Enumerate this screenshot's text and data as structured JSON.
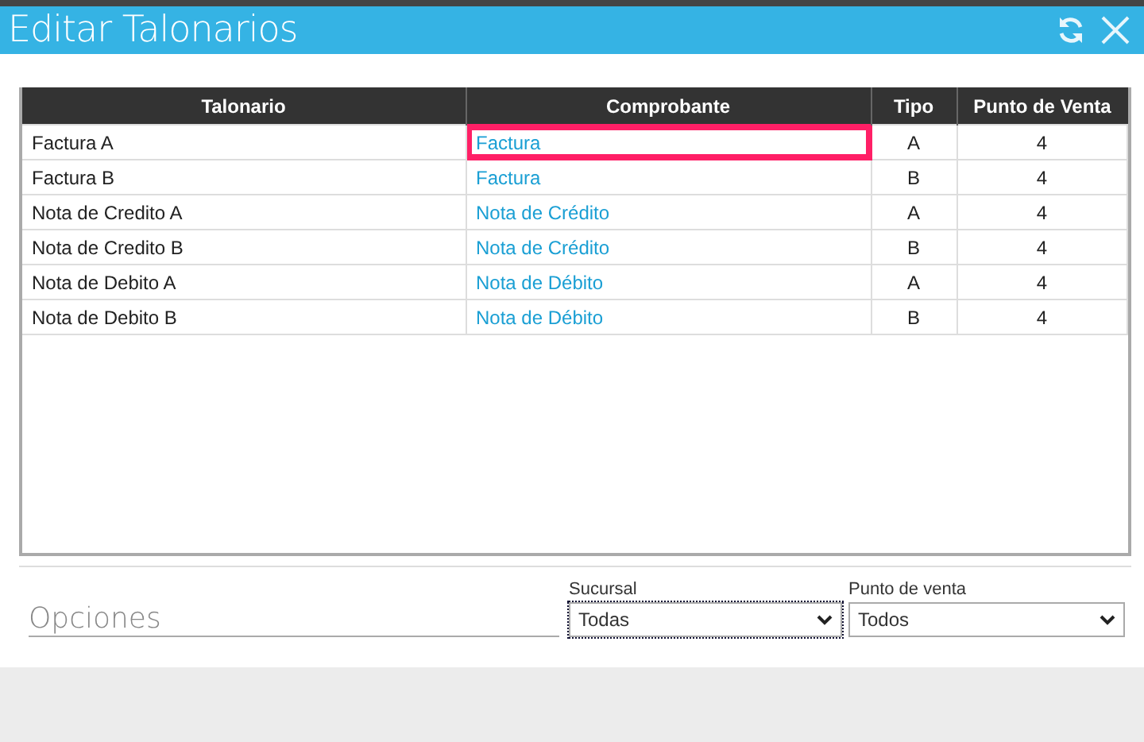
{
  "window": {
    "title": "Editar Talonarios"
  },
  "table": {
    "columns": [
      "Talonario",
      "Comprobante",
      "Tipo",
      "Punto de Venta"
    ],
    "rows": [
      {
        "talonario": "Factura A",
        "comprobante": "Factura",
        "tipo": "A",
        "punto_de_venta": "4",
        "highlighted": true
      },
      {
        "talonario": "Factura B",
        "comprobante": "Factura",
        "tipo": "B",
        "punto_de_venta": "4",
        "highlighted": false
      },
      {
        "talonario": "Nota de Credito A",
        "comprobante": "Nota de Crédito",
        "tipo": "A",
        "punto_de_venta": "4",
        "highlighted": false
      },
      {
        "talonario": "Nota de Credito B",
        "comprobante": "Nota de Crédito",
        "tipo": "B",
        "punto_de_venta": "4",
        "highlighted": false
      },
      {
        "talonario": "Nota de Debito A",
        "comprobante": "Nota de Débito",
        "tipo": "A",
        "punto_de_venta": "4",
        "highlighted": false
      },
      {
        "talonario": "Nota de Debito B",
        "comprobante": "Nota de Débito",
        "tipo": "B",
        "punto_de_venta": "4",
        "highlighted": false
      }
    ]
  },
  "options": {
    "title": "Opciones",
    "filters": [
      {
        "label": "Sucursal",
        "value": "Todas",
        "focused": true
      },
      {
        "label": "Punto de venta",
        "value": "Todos",
        "focused": false
      }
    ]
  }
}
